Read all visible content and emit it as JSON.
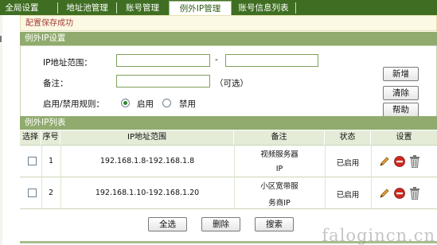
{
  "tabs": [
    {
      "label": "全局设置",
      "active": false
    },
    {
      "label": "地址池管理",
      "active": false
    },
    {
      "label": "账号管理",
      "active": false
    },
    {
      "label": "例外IP管理",
      "active": true
    },
    {
      "label": "账号信息列表",
      "active": false
    }
  ],
  "status_message": "配置保存成功",
  "form": {
    "section_title": "例外IP设置",
    "ip_range_label": "IP地址范围：",
    "ip_start_value": "",
    "ip_end_value": "",
    "range_dash": "-",
    "remark_label": "备注：",
    "remark_value": "",
    "optional_hint": "（可选）",
    "rule_label": "启用/禁用规则：",
    "enable_label": "启用",
    "disable_label": "禁用",
    "selected_rule": "启用",
    "add_button": "新增",
    "clear_button": "清除",
    "help_button": "帮助"
  },
  "list": {
    "section_title": "例外IP列表",
    "columns": [
      "选择",
      "序号",
      "IP地址范围",
      "备注",
      "状态",
      "设置"
    ],
    "rows": [
      {
        "index": "1",
        "ip_range": "192.168.1.8-192.168.1.8",
        "remark_line1": "视频服务器",
        "remark_line2": "IP",
        "status": "已启用"
      },
      {
        "index": "2",
        "ip_range": "192.168.1.10-192.168.1.20",
        "remark_line1": "小区宽带服",
        "remark_line2": "务商IP",
        "status": "已启用"
      }
    ],
    "row_icons": [
      "edit-icon",
      "disable-icon",
      "delete-icon"
    ]
  },
  "actions": {
    "select_all": "全选",
    "delete": "删除",
    "search": "搜索"
  },
  "watermark": "falogincn.cn",
  "colors": {
    "tab_bar": "#3f6e22",
    "section_header": "#90ab6d",
    "status_text": "#a6403a",
    "header_cell": "#e4ebd7"
  }
}
